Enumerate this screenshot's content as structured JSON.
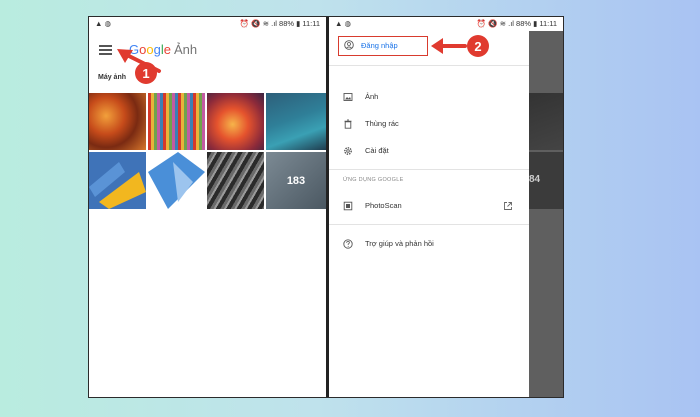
{
  "left_phone": {
    "status": {
      "left": "▲ ◍",
      "right": "⏰ 🔇 ≋ .ıl 88% ▮ 11:11"
    },
    "logo": {
      "g1": "G",
      "g2": "o",
      "g3": "o",
      "g4": "g",
      "g5": "l",
      "g6": "e",
      "app": "Ảnh"
    },
    "section_label": "Máy ảnh",
    "more_count": "183",
    "step_badge": "1"
  },
  "right_phone": {
    "status": {
      "left": "▲ ◍",
      "right": "⏰ 🔇 ≋ .ıl 88% ▮ 11:11"
    },
    "signin_label": "Đăng nhập",
    "step_badge": "2",
    "menu": {
      "photos": "Ảnh",
      "trash": "Thùng rác",
      "settings": "Cài đặt",
      "apps_heading": "ỨNG DỤNG GOOGLE",
      "photoscan": "PhotoScan",
      "help": "Trợ giúp và phản hồi"
    },
    "scrim_count": "84"
  },
  "colors": {
    "accent_red": "#d83b2e",
    "link_blue": "#1a73e8"
  }
}
